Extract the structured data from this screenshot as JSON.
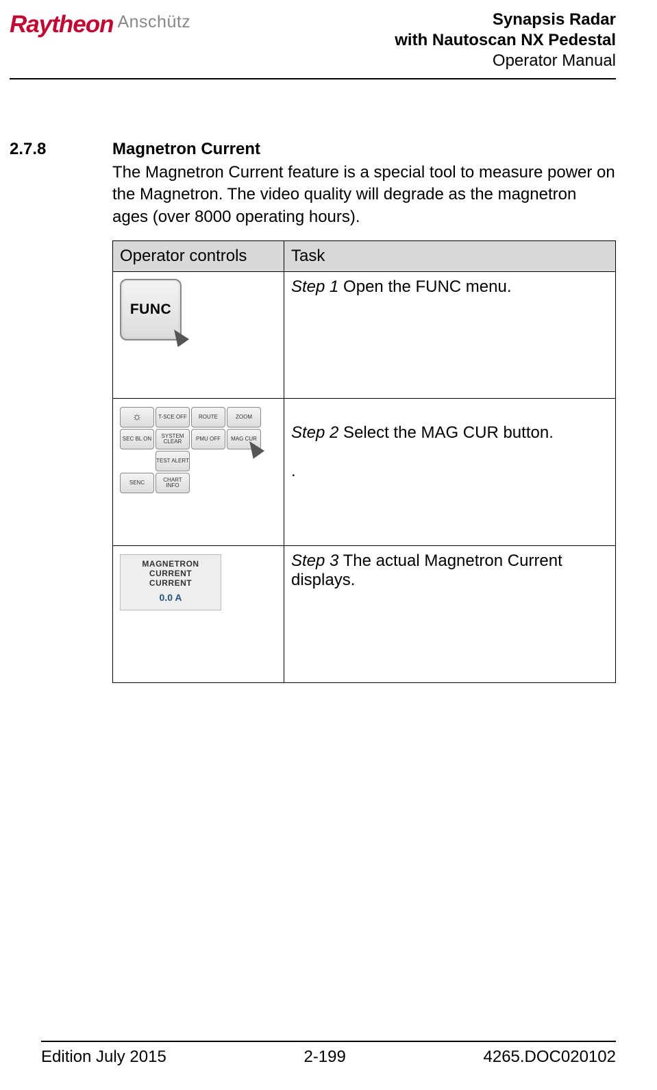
{
  "header": {
    "logo_brand": "Raytheon",
    "logo_sub": "Anschütz",
    "title_line1": "Synapsis Radar",
    "title_line2": "with Nautoscan NX Pedestal",
    "title_line3": "Operator Manual"
  },
  "section": {
    "number": "2.7.8",
    "heading": "Magnetron Current",
    "body": "The Magnetron Current feature is a special tool to measure power on the Magnetron. The video quality will degrade as the magnetron ages (over 8000 operating hours)."
  },
  "table": {
    "col1_header": "Operator controls",
    "col2_header": "Task",
    "rows": [
      {
        "step_label": "Step 1",
        "step_text": " Open the FUNC menu."
      },
      {
        "step_label": "Step 2",
        "step_text": " Select the MAG CUR button.",
        "after": "."
      },
      {
        "step_label": "Step 3",
        "step_text": " The actual Magnetron Current displays."
      }
    ],
    "func_button_label": "FUNC",
    "menu_buttons": {
      "r1": [
        "",
        "T-SCE OFF",
        "ROUTE",
        "ZOOM"
      ],
      "r1_icon": "☼",
      "r2": [
        "SEC BL ON",
        "SYSTEM CLEAR",
        "PMU OFF",
        "MAG CUR"
      ],
      "r3": [
        "",
        "TEST ALERT",
        "",
        ""
      ],
      "r4": [
        "SENC",
        "CHART INFO",
        "",
        ""
      ]
    },
    "mag_display": {
      "line1": "MAGNETRON CURRENT",
      "line2": "CURRENT",
      "value": "0.0 A"
    }
  },
  "footer": {
    "left": "Edition July 2015",
    "center": "2-199",
    "right": "4265.DOC020102"
  }
}
